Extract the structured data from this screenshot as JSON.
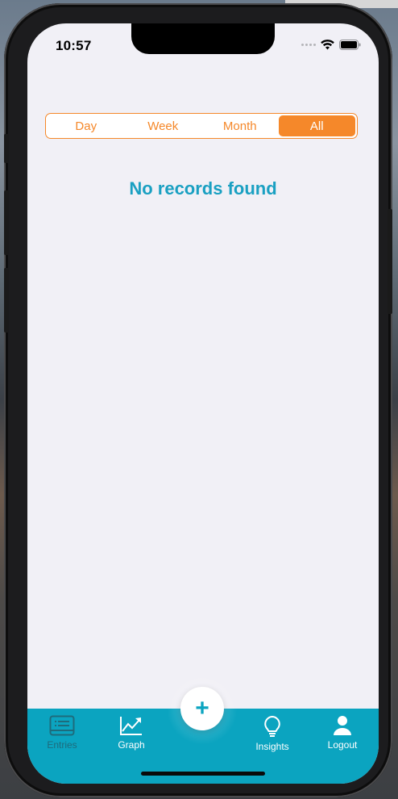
{
  "status_bar": {
    "time": "10:57"
  },
  "filter": {
    "options": [
      "Day",
      "Week",
      "Month",
      "All"
    ],
    "selected": "All"
  },
  "empty_state": {
    "message": "No records found"
  },
  "tab_bar": {
    "items": [
      {
        "label": "Entries",
        "icon": "list-icon"
      },
      {
        "label": "Graph",
        "icon": "chart-icon"
      },
      {
        "label": "Insights",
        "icon": "lightbulb-icon"
      },
      {
        "label": "Logout",
        "icon": "person-icon"
      }
    ],
    "add_button": "+"
  },
  "colors": {
    "accent_orange": "#f5882a",
    "accent_teal": "#0ba4c0",
    "message_teal": "#1aa0c2",
    "screen_bg": "#f1f0f6"
  }
}
